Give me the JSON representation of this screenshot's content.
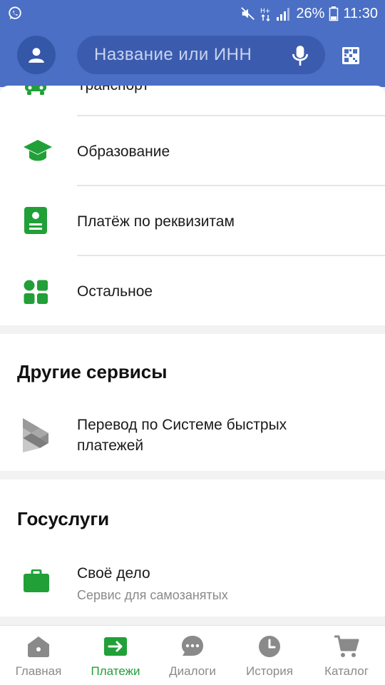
{
  "status_bar": {
    "battery": "26%",
    "time": "11:30"
  },
  "header": {
    "search_placeholder": "Название или ИНН"
  },
  "categories": [
    {
      "label": "Транспорт",
      "icon": "bus-icon"
    },
    {
      "label": "Образование",
      "icon": "graduation-cap-icon"
    },
    {
      "label": "Платёж по реквизитам",
      "icon": "document-icon"
    },
    {
      "label": "Остальное",
      "icon": "grid-icon"
    }
  ],
  "other_services": {
    "title": "Другие сервисы",
    "item_line1": "Перевод по Системе быстрых",
    "item_line2": "платежей"
  },
  "gosuslugi": {
    "title": "Госуслуги",
    "item_label": "Своё дело",
    "item_sub": "Сервис для самозанятых"
  },
  "bottom_nav": [
    {
      "label": "Главная",
      "icon": "home-icon"
    },
    {
      "label": "Платежи",
      "icon": "payments-icon",
      "active": true
    },
    {
      "label": "Диалоги",
      "icon": "chat-icon"
    },
    {
      "label": "История",
      "icon": "clock-icon"
    },
    {
      "label": "Каталог",
      "icon": "cart-icon"
    }
  ],
  "colors": {
    "brand_green": "#21a038",
    "header_blue": "#4a6fc4"
  }
}
